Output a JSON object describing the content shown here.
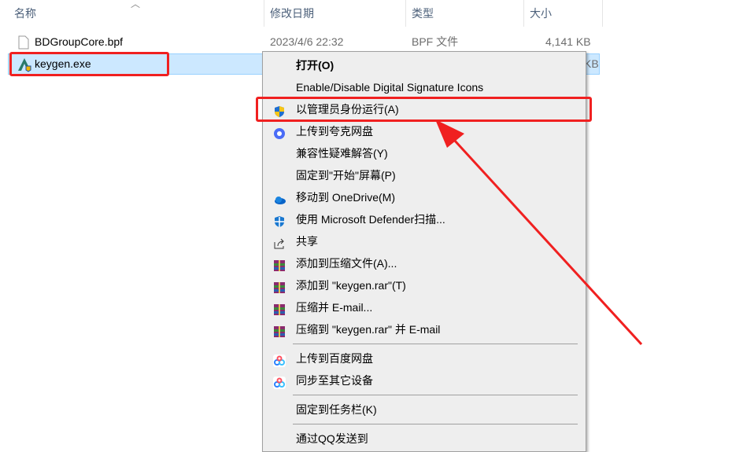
{
  "columns": {
    "name": "名称",
    "date": "修改日期",
    "type": "类型",
    "size": "大小"
  },
  "files": [
    {
      "name": "BDGroupCore.bpf",
      "date": "2023/4/6 22:32",
      "type": "BPF 文件",
      "size": "4,141 KB"
    },
    {
      "name": "keygen.exe",
      "size": "KB"
    }
  ],
  "menu": {
    "items": [
      {
        "label": "打开(O)",
        "icon": ""
      },
      {
        "label": "Enable/Disable Digital Signature Icons",
        "icon": ""
      },
      {
        "label": "以管理员身份运行(A)",
        "icon": "uac-shield-icon"
      },
      {
        "label": "上传到夸克网盘",
        "icon": "quark-cloud-icon"
      },
      {
        "label": "兼容性疑难解答(Y)",
        "icon": ""
      },
      {
        "label": "固定到\"开始\"屏幕(P)",
        "icon": ""
      },
      {
        "label": "移动到 OneDrive(M)",
        "icon": "onedrive-icon"
      },
      {
        "label": "使用 Microsoft Defender扫描...",
        "icon": "defender-icon"
      },
      {
        "label": "共享",
        "icon": "share-icon"
      },
      {
        "label": "添加到压缩文件(A)...",
        "icon": "winrar-icon"
      },
      {
        "label": "添加到 \"keygen.rar\"(T)",
        "icon": "winrar-icon"
      },
      {
        "label": "压缩并 E-mail...",
        "icon": "winrar-icon"
      },
      {
        "label": "压缩到 \"keygen.rar\" 并 E-mail",
        "icon": "winrar-icon"
      },
      {
        "label": "上传到百度网盘",
        "icon": "baidu-netdisk-icon"
      },
      {
        "label": "同步至其它设备",
        "icon": "baidu-netdisk-icon"
      },
      {
        "label": "固定到任务栏(K)",
        "icon": ""
      },
      {
        "label": "通过QQ发送到",
        "icon": ""
      }
    ]
  },
  "colors": {
    "highlight": "#f02020",
    "selection": "#cce8ff"
  }
}
